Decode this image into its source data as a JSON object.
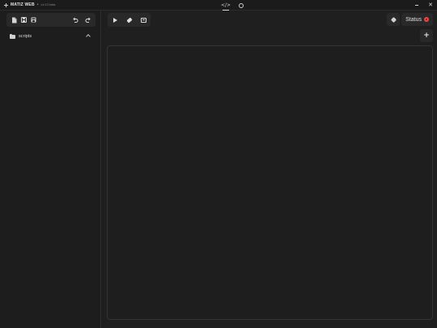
{
  "titlebar": {
    "app_title": "MATIZ WEB",
    "separator": "•",
    "version": "v1.0.0 beta",
    "tabs": [
      {
        "icon": "code-icon",
        "glyph": "</>",
        "active": true
      },
      {
        "icon": "gear-icon",
        "active": false
      }
    ],
    "close_glyph": "✕"
  },
  "sidebar": {
    "toolbar_icons": [
      "new-file-icon",
      "save-icon",
      "save-all-icon",
      "undo-icon",
      "redo-icon"
    ],
    "tree": [
      {
        "label": "scripts",
        "icon": "folder-icon",
        "expanded": true
      }
    ]
  },
  "main": {
    "toolbar_icons": [
      "play-icon",
      "eraser-icon",
      "console-icon"
    ],
    "status": {
      "label": "Status",
      "color": "#e84a4a"
    },
    "add_glyph": "+"
  }
}
